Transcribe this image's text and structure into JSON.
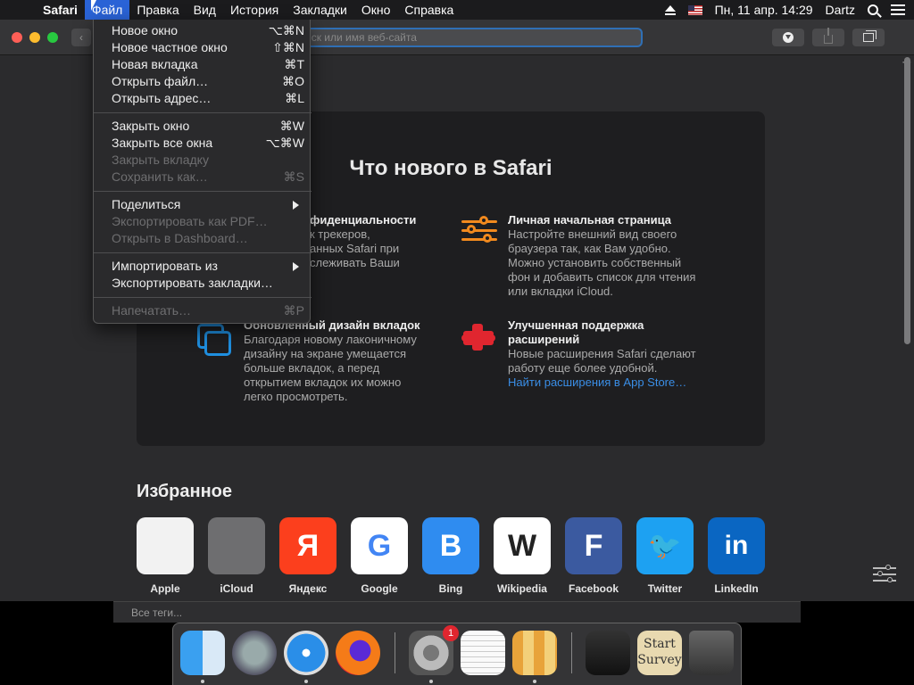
{
  "menubar": {
    "app": "Safari",
    "items": [
      "Файл",
      "Правка",
      "Вид",
      "История",
      "Закладки",
      "Окно",
      "Справка"
    ],
    "datetime": "Пн, 11 апр.  14:29",
    "user": "Dartz"
  },
  "toolbar": {
    "address_placeholder": "иск или имя веб-сайта"
  },
  "file_menu": {
    "items": [
      {
        "label": "Новое окно",
        "shortcut": "⌥⌘N",
        "enabled": true
      },
      {
        "label": "Новое частное окно",
        "shortcut": "⇧⌘N",
        "enabled": true
      },
      {
        "label": "Новая вкладка",
        "shortcut": "⌘T",
        "enabled": true
      },
      {
        "label": "Открыть файл…",
        "shortcut": "⌘O",
        "enabled": true
      },
      {
        "label": "Открыть адрес…",
        "shortcut": "⌘L",
        "enabled": true
      },
      {
        "label": "Закрыть окно",
        "shortcut": "⌘W",
        "enabled": true
      },
      {
        "label": "Закрыть все окна",
        "shortcut": "⌥⌘W",
        "enabled": true
      },
      {
        "label": "Закрыть вкладку",
        "shortcut": "",
        "enabled": false
      },
      {
        "label": "Сохранить как…",
        "shortcut": "⌘S",
        "enabled": false
      },
      {
        "label": "Поделиться",
        "shortcut": "",
        "enabled": true,
        "submenu": true
      },
      {
        "label": "Экспортировать как PDF…",
        "shortcut": "",
        "enabled": false
      },
      {
        "label": "Открыть в Dashboard…",
        "shortcut": "",
        "enabled": false
      },
      {
        "label": "Импортировать из",
        "shortcut": "",
        "enabled": true,
        "submenu": true
      },
      {
        "label": "Экспортировать закладки…",
        "shortcut": "",
        "enabled": true
      },
      {
        "label": "Напечатать…",
        "shortcut": "⌘P",
        "enabled": false
      }
    ]
  },
  "whats_new": {
    "title": "Что нового в Safari",
    "features": [
      {
        "title": "фиденциальности",
        "text": [
          "к трекеров,",
          "анных Safari при",
          "слеживать Ваши"
        ]
      },
      {
        "title": "Личная начальная страница",
        "text": [
          "Настройте внешний вид своего",
          "браузера так, как Вам удобно.",
          "Можно установить собственный",
          "фон и добавить список для чтения",
          "или вкладки iCloud."
        ]
      },
      {
        "title": "Обновленный дизайн вкладок",
        "text": [
          "Благодаря новому лаконичному",
          "дизайну на экране умещается",
          "больше вкладок, а перед",
          "открытием вкладок их можно",
          "легко просмотреть."
        ]
      },
      {
        "title": "Улучшенная поддержка",
        "title2": "расширений",
        "text": [
          "Новые расширения Safari сделают",
          "работу еще более удобной."
        ],
        "link": "Найти расширения в App Store…"
      }
    ]
  },
  "favorites": {
    "title": "Избранное",
    "items": [
      {
        "label": "Apple",
        "glyph": "",
        "icon": "apple-icon",
        "bg": "#f2f2f2",
        "fg": "#555"
      },
      {
        "label": "iCloud",
        "glyph": "",
        "icon": "icloud-icon",
        "bg": "#6e6e70",
        "fg": "#999"
      },
      {
        "label": "Яндекс",
        "glyph": "Я",
        "icon": "yandex-icon",
        "bg": "#fc3f1d",
        "fg": "#ffffff"
      },
      {
        "label": "Google",
        "glyph": "G",
        "icon": "google-icon",
        "bg": "#ffffff",
        "fg": "#4285f4"
      },
      {
        "label": "Bing",
        "glyph": "B",
        "icon": "bing-icon",
        "bg": "#2f8cf0",
        "fg": "#ffffff"
      },
      {
        "label": "Wikipedia",
        "glyph": "W",
        "icon": "wikipedia-icon",
        "bg": "#ffffff",
        "fg": "#222222"
      },
      {
        "label": "Facebook",
        "glyph": "F",
        "icon": "facebook-icon",
        "bg": "#3b5aa0",
        "fg": "#ffffff"
      },
      {
        "label": "Twitter",
        "glyph": "🐦",
        "icon": "twitter-icon",
        "bg": "#1da1f2",
        "fg": "#ffffff"
      },
      {
        "label": "LinkedIn",
        "glyph": "in",
        "icon": "linkedin-icon",
        "bg": "#0a66c2",
        "fg": "#ffffff"
      }
    ]
  },
  "background_window": {
    "tags_label": "Все теги..."
  },
  "dock": {
    "settings_badge": "1",
    "survey_label": "Start Survey"
  },
  "colors": {
    "menu_highlight": "#2a63d6",
    "accent_orange": "#f28a1e",
    "accent_blue": "#1f8fe0",
    "accent_red": "#e0262f",
    "link": "#3a8ee6"
  }
}
